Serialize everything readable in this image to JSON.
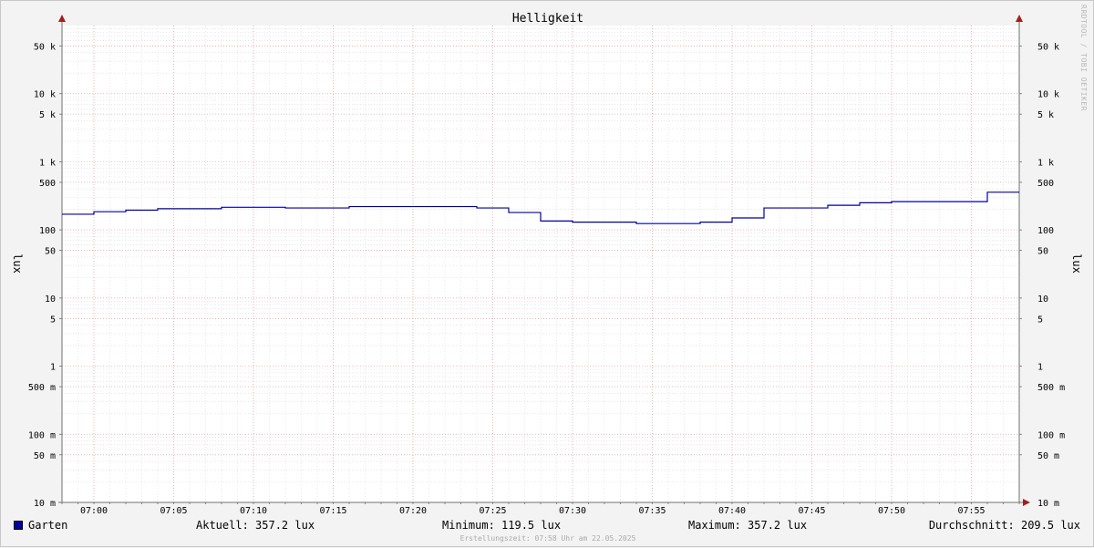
{
  "chart_data": {
    "type": "line",
    "title": "Helligkeit",
    "ylabel": "lux",
    "yscale": "log",
    "ylim": [
      0.01,
      100000
    ],
    "xlim": [
      "06:58",
      "07:58"
    ],
    "grid": true,
    "y_ticks": [
      {
        "value": 50000,
        "label": "50 k"
      },
      {
        "value": 10000,
        "label": "10 k"
      },
      {
        "value": 5000,
        "label": "5 k"
      },
      {
        "value": 1000,
        "label": "1 k"
      },
      {
        "value": 500,
        "label": "500"
      },
      {
        "value": 100,
        "label": "100"
      },
      {
        "value": 50,
        "label": "50"
      },
      {
        "value": 10,
        "label": "10"
      },
      {
        "value": 5,
        "label": "5"
      },
      {
        "value": 1,
        "label": "1"
      },
      {
        "value": 0.5,
        "label": "500 m"
      },
      {
        "value": 0.1,
        "label": "100 m"
      },
      {
        "value": 0.05,
        "label": "50 m"
      },
      {
        "value": 0.01,
        "label": "10 m"
      }
    ],
    "x_ticks": [
      "07:00",
      "07:05",
      "07:10",
      "07:15",
      "07:20",
      "07:25",
      "07:30",
      "07:35",
      "07:40",
      "07:45",
      "07:50",
      "07:55"
    ],
    "series": [
      {
        "name": "Garten",
        "color": "#0000a0",
        "step": true,
        "x": [
          "06:58",
          "07:00",
          "07:02",
          "07:04",
          "07:08",
          "07:12",
          "07:16",
          "07:24",
          "07:26",
          "07:28",
          "07:30",
          "07:34",
          "07:38",
          "07:40",
          "07:42",
          "07:46",
          "07:48",
          "07:50",
          "07:56",
          "07:58"
        ],
        "y": [
          170,
          185,
          195,
          205,
          215,
          210,
          220,
          210,
          180,
          135,
          130,
          124,
          130,
          150,
          210,
          230,
          250,
          260,
          357.2,
          357.2
        ]
      }
    ]
  },
  "legend": {
    "series_name": "Garten",
    "aktuell": "Aktuell: 357.2 lux",
    "minimum": "Minimum: 119.5 lux",
    "maximum": "Maximum: 357.2 lux",
    "durchschnitt": "Durchschnitt: 209.5 lux"
  },
  "footer": "Erstellungszeit: 07:58 Uhr am 22.05.2025",
  "watermark": "RRDTOOL / TOBI OETIKER"
}
